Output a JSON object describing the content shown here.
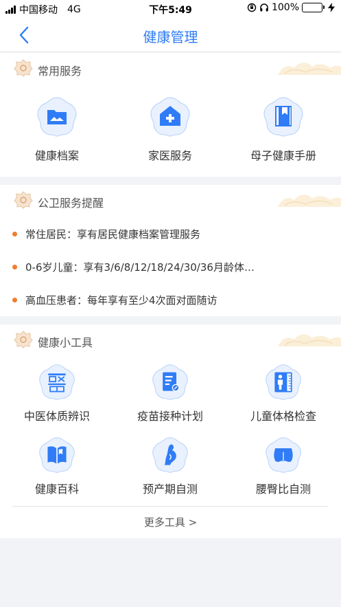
{
  "status_bar": {
    "carrier": "中国移动",
    "network": "4G",
    "time": "下午5:49",
    "battery": "100%",
    "battery_level": 1.0,
    "icons": [
      "orientation-lock-icon",
      "headphones-icon",
      "battery-icon",
      "charging-bolt-icon"
    ]
  },
  "nav": {
    "title": "健康管理",
    "back_icon": "chevron-left-icon"
  },
  "colors": {
    "accent": "#2f7cf6",
    "icon_light": "#e9f1fe",
    "icon_ring": "#bcd5fb",
    "dot": "#f07d2c",
    "badge": "#f1d3b4"
  },
  "common_services": {
    "title": "常用服务",
    "items": [
      {
        "label": "健康档案",
        "icon": "folder-icon"
      },
      {
        "label": "家医服务",
        "icon": "home-plus-icon"
      },
      {
        "label": "母子健康手册",
        "icon": "handbook-icon"
      }
    ]
  },
  "reminders": {
    "title": "公卫服务提醒",
    "items": [
      {
        "text": "常住居民：享有居民健康档案管理服务"
      },
      {
        "text": "0-6岁儿童：享有3/6/8/12/18/24/30/36月龄体…"
      },
      {
        "text": "高血压患者：每年享有至少4次面对面随访"
      }
    ]
  },
  "tools": {
    "title": "健康小工具",
    "items": [
      {
        "label": "中医体质辨识",
        "icon": "tcm-icon"
      },
      {
        "label": "疫苗接种计划",
        "icon": "vaccine-plan-icon"
      },
      {
        "label": "儿童体格检查",
        "icon": "child-height-icon"
      },
      {
        "label": "健康百科",
        "icon": "encyclopedia-icon"
      },
      {
        "label": "预产期自测",
        "icon": "pregnancy-icon"
      },
      {
        "label": "腰臀比自测",
        "icon": "waist-hip-icon"
      }
    ],
    "more_label": "更多工具 >"
  }
}
